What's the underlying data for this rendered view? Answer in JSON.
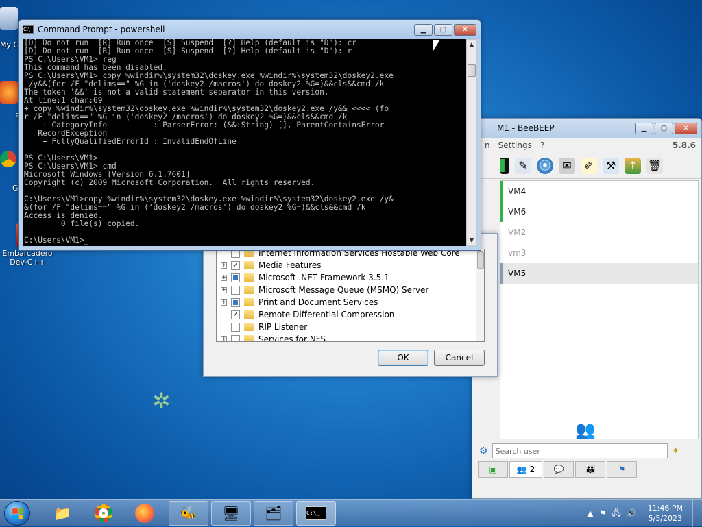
{
  "desktop": {
    "icons": [
      {
        "label": "My C",
        "icon": "computer-icon"
      },
      {
        "label": "F",
        "icon": "firefox-shortcut-icon"
      },
      {
        "label": "G\nC",
        "icon": "chrome-shortcut-icon"
      },
      {
        "label": "Embarcadero\nDev-C++",
        "icon": "devcpp-icon"
      }
    ]
  },
  "cmd": {
    "title": "Command Prompt - powershell",
    "lines": [
      "[D] Do not run  [R] Run once  [S] Suspend  [?] Help (default is \"D\"): cr",
      "[D] Do not run  [R] Run once  [S] Suspend  [?] Help (default is \"D\"): r",
      "PS C:\\Users\\VM1> reg",
      "This command has been disabled.",
      "PS C:\\Users\\VM1> copy %windir%\\system32\\doskey.exe %windir%\\system32\\doskey2.exe",
      " /y&&(for /F \"delims==\" %G in ('doskey2 /macros') do doskey2 %G=)&&cls&&cmd /k",
      "The token '&&' is not a valid statement separator in this version.",
      "At line:1 char:69",
      "+ copy %windir%\\system32\\doskey.exe %windir%\\system32\\doskey2.exe /y&& <<<< (fo",
      "r /F \"delims==\" %G in ('doskey2 /macros') do doskey2 %G=)&&cls&&cmd /k",
      "    + CategoryInfo          : ParserError: (&&:String) [], ParentContainsError",
      "   RecordException",
      "    + FullyQualifiedErrorId : InvalidEndOfLine",
      "",
      "PS C:\\Users\\VM1>",
      "PS C:\\Users\\VM1> cmd",
      "Microsoft Windows [Version 6.1.7601]",
      "Copyright (c) 2009 Microsoft Corporation.  All rights reserved.",
      "",
      "C:\\Users\\VM1>copy %windir%\\system32\\doskey.exe %windir%\\system32\\doskey2.exe /y&",
      "&(for /F \"delims==\" %G in ('doskey2 /macros') do doskey2 %G=)&&cls&&cmd /k",
      "Access is denied.",
      "        0 file(s) copied.",
      "",
      "C:\\Users\\VM1>_"
    ]
  },
  "beebeep": {
    "title": "M1 - BeeBEEP",
    "menu": [
      "n",
      "Settings",
      "?"
    ],
    "version": "5.8.6",
    "users": [
      {
        "name": "VM4",
        "status": "online"
      },
      {
        "name": "VM6",
        "status": "online"
      },
      {
        "name": "VM2",
        "status": "offline"
      },
      {
        "name": "vm3",
        "status": "offline"
      },
      {
        "name": "VM5",
        "status": "selected"
      }
    ],
    "search_placeholder": "Search user",
    "tab_count": "2"
  },
  "features": {
    "items": [
      {
        "label": "Internet Information Services Hostable Web Core",
        "state": "unchecked",
        "expandable": false
      },
      {
        "label": "Media Features",
        "state": "checked",
        "expandable": true
      },
      {
        "label": "Microsoft .NET Framework 3.5.1",
        "state": "partial",
        "expandable": true
      },
      {
        "label": "Microsoft Message Queue (MSMQ) Server",
        "state": "unchecked",
        "expandable": true
      },
      {
        "label": "Print and Document Services",
        "state": "partial",
        "expandable": true
      },
      {
        "label": "Remote Differential Compression",
        "state": "checked",
        "expandable": false
      },
      {
        "label": "RIP Listener",
        "state": "unchecked",
        "expandable": false
      },
      {
        "label": "Services for NFS",
        "state": "unchecked",
        "expandable": true
      }
    ],
    "ok_label": "OK",
    "cancel_label": "Cancel"
  },
  "taskbar": {
    "pinned": [
      {
        "name": "explorer-icon"
      },
      {
        "name": "chrome-icon"
      },
      {
        "name": "firefox-icon"
      },
      {
        "name": "beebeep-icon"
      },
      {
        "name": "control-panel-icon"
      },
      {
        "name": "files-icon"
      },
      {
        "name": "cmd-icon"
      }
    ],
    "time": "11:46 PM",
    "date": "5/5/2023"
  }
}
